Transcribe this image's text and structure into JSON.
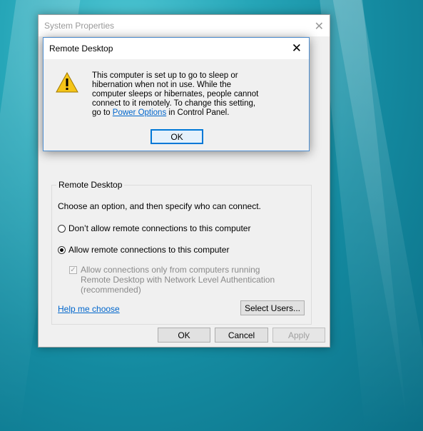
{
  "system_properties": {
    "title": "System Properties",
    "remote_group": {
      "legend": "Remote Desktop",
      "instruction": "Choose an option, and then specify who can connect.",
      "option_deny": "Don’t allow remote connections to this computer",
      "option_allow": "Allow remote connections to this computer",
      "selected": "allow",
      "nla_checkbox": "Allow connections only from computers running Remote Desktop with Network Level Authentication (recommended)",
      "nla_checked": true,
      "help_link": "Help me choose",
      "select_users": "Select Users..."
    },
    "buttons": {
      "ok": "OK",
      "cancel": "Cancel",
      "apply": "Apply"
    }
  },
  "dialog": {
    "title": "Remote Desktop",
    "icon": "warning-icon",
    "message_part1": "This computer is set up to go to sleep or hibernation when not in use. While the computer sleeps or hibernates, people cannot connect to it remotely. To change this setting, go to ",
    "link": "Power Options",
    "message_part2": " in Control Panel.",
    "ok": "OK"
  },
  "colors": {
    "accent": "#0078d7",
    "link": "#0066cc",
    "warning": "#f5c518"
  }
}
